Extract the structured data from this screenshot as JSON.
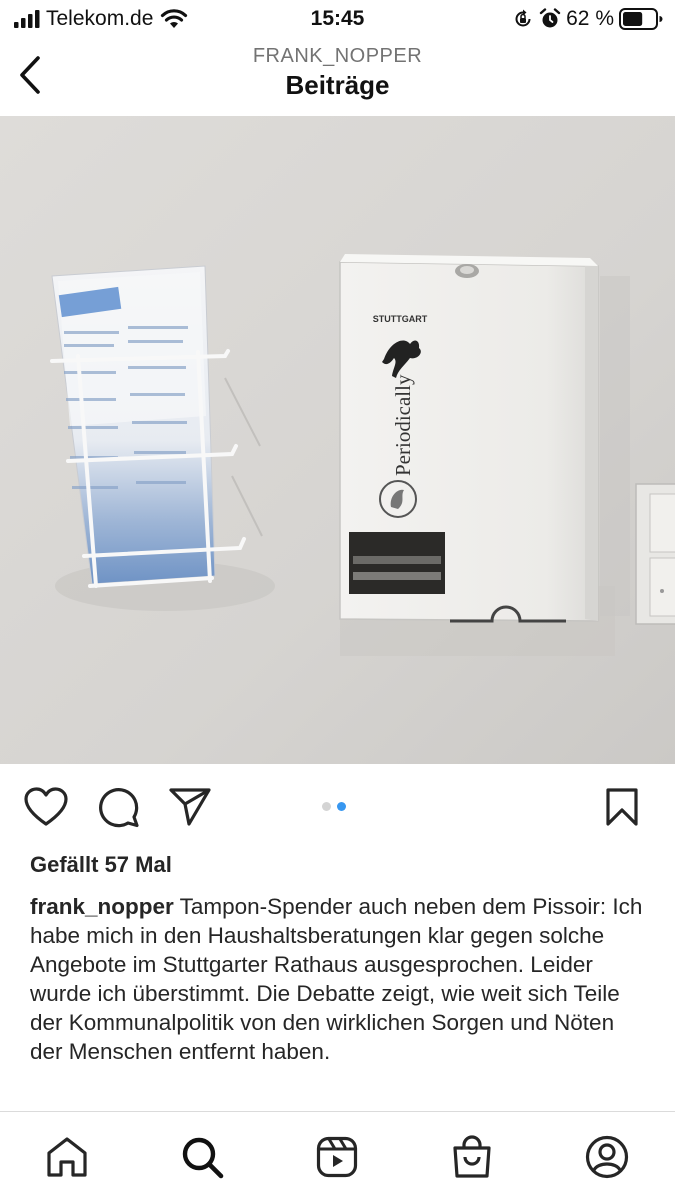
{
  "status_bar": {
    "carrier": "Telekom.de",
    "time": "15:45",
    "battery_percent": "62 %",
    "battery_level": 0.62
  },
  "header": {
    "username": "FRANK_NOPPER",
    "title": "Beiträge"
  },
  "post": {
    "image_text": {
      "brand": "STUTTGART",
      "product": "Periodically"
    },
    "carousel": {
      "count": 2,
      "active_index": 1
    },
    "likes_text": "Gefällt 57 Mal",
    "caption_user": "frank_nopper",
    "caption_text": "Tampon-Spender auch neben dem Pissoir: Ich habe mich in den Haushaltsberatungen klar gegen solche Angebote im Stuttgarter Rathaus ausgesprochen. Leider wurde ich überstimmt. Die Debatte zeigt, wie weit sich Teile der Kommunalpolitik von den wirklichen Sorgen und Nöten der Menschen entfernt haben."
  },
  "icons": {
    "back": "chevron-left-icon",
    "like": "heart-icon",
    "comment": "comment-icon",
    "share": "send-icon",
    "save": "bookmark-icon"
  },
  "bottom_nav": [
    {
      "name": "home",
      "icon": "home-icon"
    },
    {
      "name": "search",
      "icon": "search-icon",
      "active": true
    },
    {
      "name": "reels",
      "icon": "reels-icon"
    },
    {
      "name": "shop",
      "icon": "shop-icon"
    },
    {
      "name": "profile",
      "icon": "profile-icon"
    }
  ],
  "colors": {
    "text": "#262626",
    "muted": "#737373",
    "accent": "#3897f0",
    "divider": "#dbdbdb"
  }
}
